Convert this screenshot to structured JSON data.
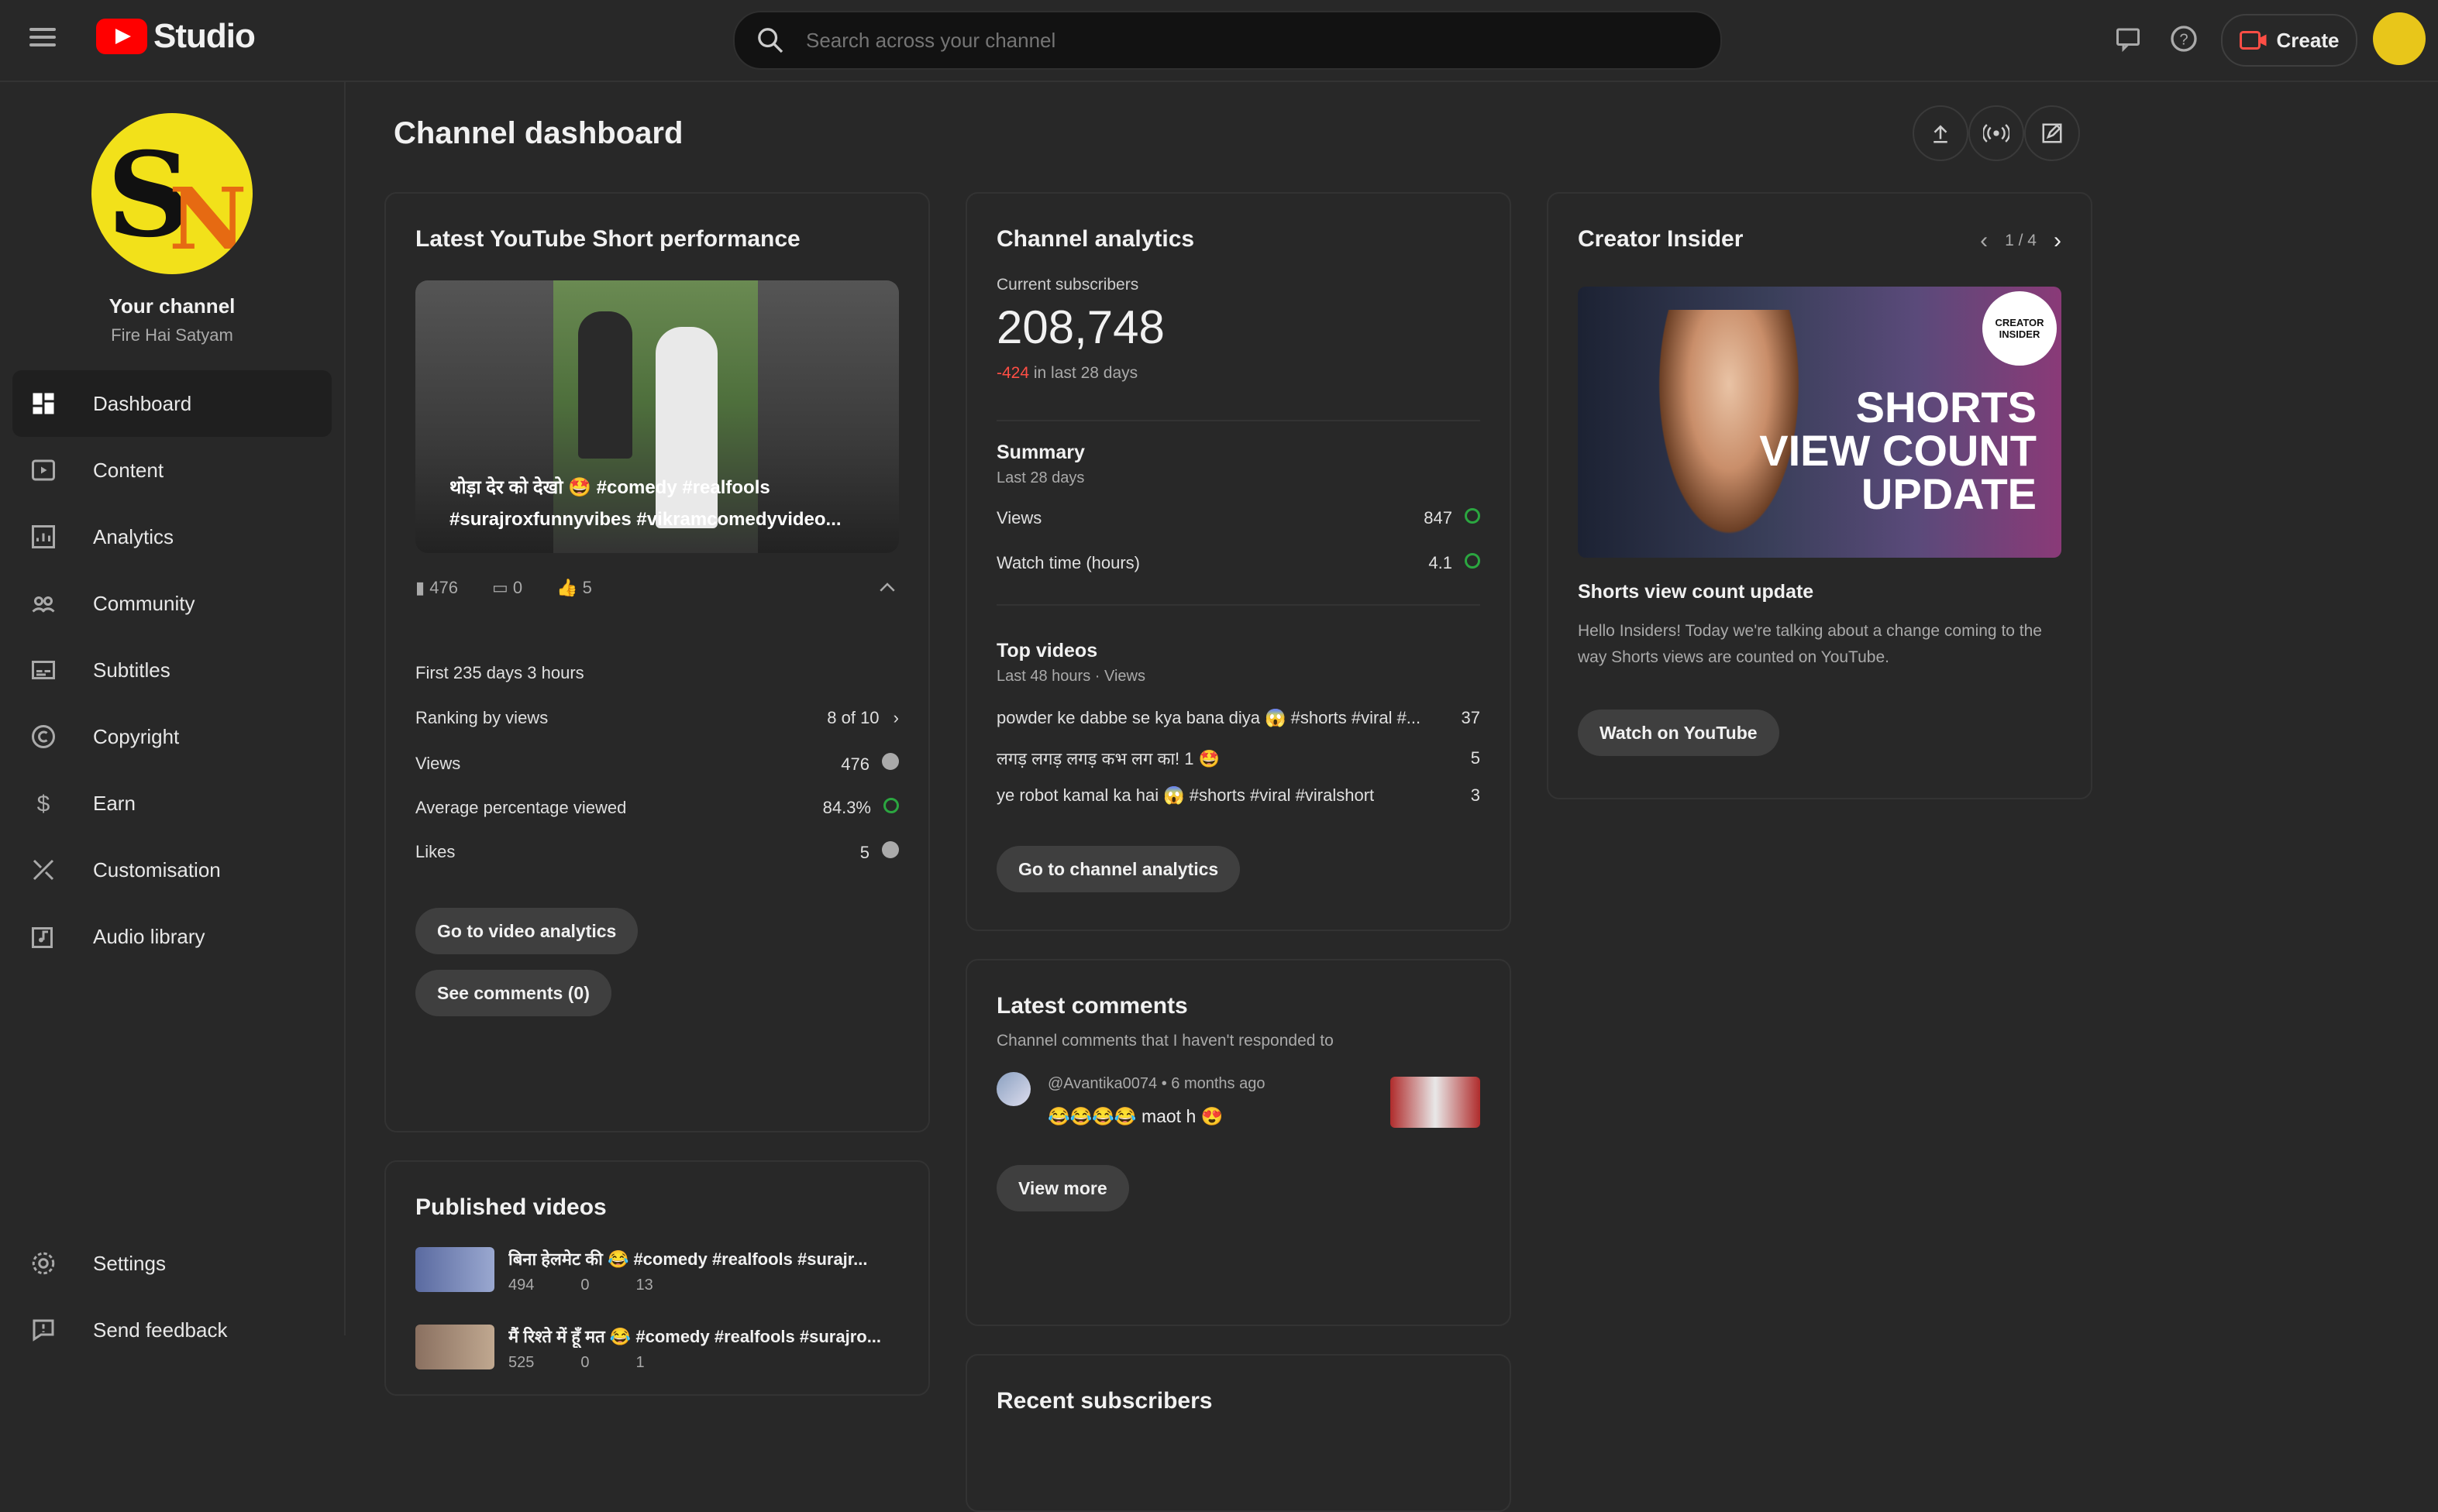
{
  "topbar": {
    "brand": "Studio",
    "search_placeholder": "Search across your channel",
    "create_label": "Create"
  },
  "sidebar": {
    "channel_name": "Your channel",
    "channel_handle": "Fire Hai Satyam",
    "items": [
      {
        "label": "Dashboard",
        "icon": "dashboard-icon",
        "active": true
      },
      {
        "label": "Content",
        "icon": "content-icon"
      },
      {
        "label": "Analytics",
        "icon": "analytics-icon"
      },
      {
        "label": "Community",
        "icon": "community-icon"
      },
      {
        "label": "Subtitles",
        "icon": "subtitles-icon"
      },
      {
        "label": "Copyright",
        "icon": "copyright-icon"
      },
      {
        "label": "Earn",
        "icon": "dollar-icon"
      },
      {
        "label": "Customisation",
        "icon": "customisation-icon"
      },
      {
        "label": "Audio library",
        "icon": "audio-library-icon"
      }
    ],
    "bottom_items": [
      {
        "label": "Settings",
        "icon": "gear-icon"
      },
      {
        "label": "Send feedback",
        "icon": "feedback-icon"
      }
    ]
  },
  "dashboard": {
    "title": "Channel dashboard"
  },
  "short_card": {
    "title": "Latest YouTube Short performance",
    "caption": "थोड़ा देर को देखो 🤩 #comedy #realfools #surajroxfunnyvibes #vikramcomedyvideo...",
    "stats": {
      "views": "476",
      "comments": "0",
      "likes": "5"
    },
    "first_time": "First 235 days 3 hours",
    "rows": [
      {
        "label": "Ranking by views",
        "value": "8 of 10"
      },
      {
        "label": "Views",
        "value": "476"
      },
      {
        "label": "Average percentage viewed",
        "value": "84.3%"
      },
      {
        "label": "Likes",
        "value": "5"
      }
    ],
    "btn_analytics": "Go to video analytics",
    "btn_comments": "See comments (0)"
  },
  "published_card": {
    "title": "Published videos",
    "videos": [
      {
        "title": "बिना हेलमेट की 😂 #comedy #realfools #surajr...",
        "views": "494",
        "comments": "0",
        "likes": "13"
      },
      {
        "title": "मैं रिश्ते में हूँ मत 😂 #comedy #realfools #surajro...",
        "views": "525",
        "comments": "0",
        "likes": "1"
      }
    ]
  },
  "analytics_card": {
    "title": "Channel analytics",
    "subs_label": "Current subscribers",
    "subs_value": "208,748",
    "subs_change": "-424",
    "subs_change_suffix": "in last 28 days",
    "summary_title": "Summary",
    "summary_sub": "Last 28 days",
    "summary_rows": [
      {
        "label": "Views",
        "value": "847"
      },
      {
        "label": "Watch time (hours)",
        "value": "4.1"
      }
    ],
    "top_title": "Top videos",
    "top_sub": "Last 48 hours · Views",
    "top_videos": [
      {
        "title": "powder ke dabbe se kya bana diya 😱 #shorts #viral #...",
        "value": "37"
      },
      {
        "title": "लगड़ लगड़ लगड़ कभ लग का! 1 🤩",
        "value": "5"
      },
      {
        "title": "ye robot kamal ka hai 😱 #shorts #viral #viralshort",
        "value": "3"
      }
    ],
    "btn": "Go to channel analytics"
  },
  "comments_card": {
    "title": "Latest comments",
    "sub": "Channel comments that I haven't responded to",
    "author": "@Avantika0074 • 6 months ago",
    "text": "😂😂😂😂 maot h 😍",
    "btn": "View more"
  },
  "subs_card": {
    "title": "Recent subscribers"
  },
  "insider_card": {
    "title": "Creator Insider",
    "pager": "1 / 4",
    "thumb_badge": "CREATOR INSIDER",
    "thumb_text": "SHORTS VIEW COUNT UPDATE",
    "video_title": "Shorts view count update",
    "desc": "Hello Insiders! Today we're talking about a change coming to the way Shorts views are counted on YouTube.",
    "btn": "Watch on YouTube"
  },
  "colors": {
    "accent": "#ff0000",
    "positive": "#2ba640",
    "negative": "#ff4e45"
  }
}
